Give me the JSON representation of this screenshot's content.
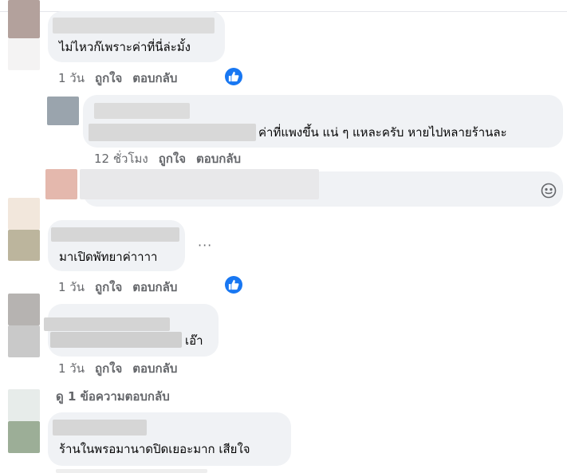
{
  "comments": [
    {
      "text": "ไม่ไหวก๊เพราะค่าที่นี่ล่ะมั้ง",
      "time": "1 วัน",
      "like": "ถูกใจ",
      "reply": "ตอบกลับ"
    },
    {
      "text": "ค่าที่แพงขึ้น แน่ ๆ แหละครับ หายไปหลายร้านละ",
      "time": "12 ชั่วโมง",
      "like": "ถูกใจ",
      "reply": "ตอบกลับ"
    },
    {
      "text": "มาเปิดพัทยาค่าาาา",
      "time": "1 วัน",
      "like": "ถูกใจ",
      "reply": "ตอบกลับ",
      "more": "···"
    },
    {
      "text": "เอ๊า",
      "time": "1 วัน",
      "like": "ถูกใจ",
      "reply": "ตอบกลับ"
    },
    {
      "text": "ร้านในพรอมานาดปิดเยอะมาก เสียใจ"
    }
  ],
  "view_replies": "ดู 1 ข้อความตอบกลับ",
  "icons": {
    "like_reaction": "thumbs-up-icon",
    "emoji": "emoji-icon"
  },
  "colors": {
    "bubble": "#f0f2f5",
    "accent": "#1877f2",
    "secondary_text": "#65676b"
  }
}
